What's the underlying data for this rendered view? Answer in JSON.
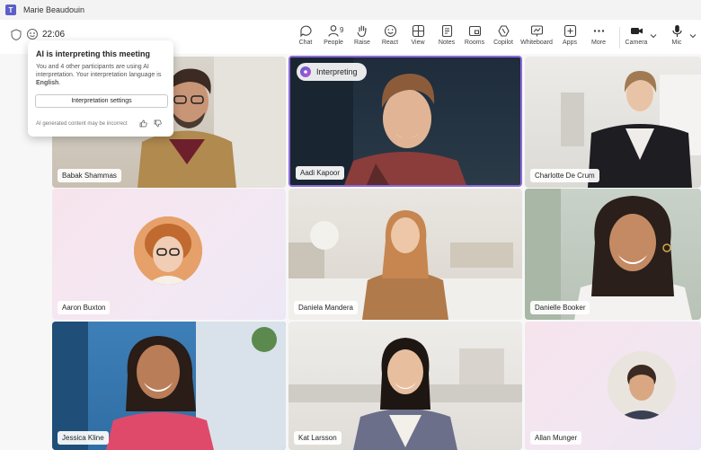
{
  "window": {
    "title": "Marie Beaudouin"
  },
  "meeting": {
    "timer": "22:06"
  },
  "toolbar": {
    "chat": "Chat",
    "people": "People",
    "people_count": "9",
    "raise": "Raise",
    "react": "React",
    "view": "View",
    "notes": "Notes",
    "rooms": "Rooms",
    "copilot": "Copilot",
    "whiteboard": "Whiteboard",
    "apps": "Apps",
    "more": "More",
    "camera": "Camera",
    "mic": "Mic"
  },
  "popup": {
    "title": "AI is interpreting this meeting",
    "body_prefix": "You and 4 other participants are using AI interpretation. Your interpretation language is ",
    "language": "English",
    "body_suffix": ".",
    "settings_button": "Interpretation settings",
    "footer": "AI generated content may be incorrect"
  },
  "badge": {
    "interpreting": "Interpreting"
  },
  "participants": [
    {
      "name": "Babak Shammas"
    },
    {
      "name": "Aadi Kapoor"
    },
    {
      "name": "Charlotte De Crum"
    },
    {
      "name": "Aaron Buxton"
    },
    {
      "name": "Daniela Mandera"
    },
    {
      "name": "Danielle Booker"
    },
    {
      "name": "Jessica Kline"
    },
    {
      "name": "Kat Larsson"
    },
    {
      "name": "Allan Munger"
    }
  ],
  "colors": {
    "accent": "#5b5fc7",
    "active_speaker": "#8b6bd8"
  }
}
